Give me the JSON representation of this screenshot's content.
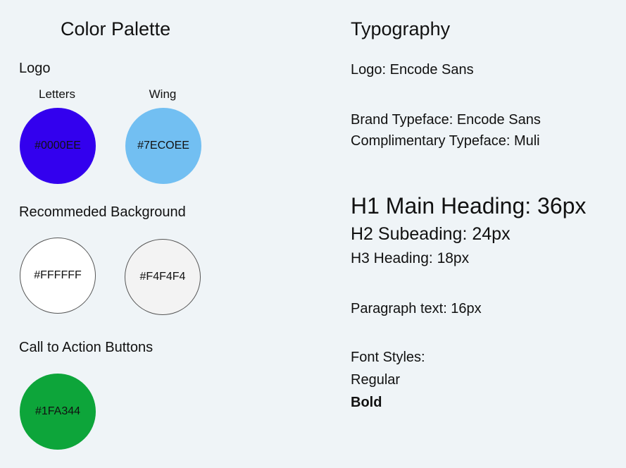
{
  "color_palette": {
    "title": "Color Palette",
    "logo": {
      "label": "Logo",
      "swatches": [
        {
          "caption": "Letters",
          "hex_label": "#0000EE",
          "color": "#3300EE"
        },
        {
          "caption": "Wing",
          "hex_label": "#7ECOEE",
          "color": "#72BFF2"
        }
      ]
    },
    "background": {
      "label": "Recommeded Background",
      "swatches": [
        {
          "hex_label": "#FFFFFF",
          "color": "#FFFFFF"
        },
        {
          "hex_label": "#F4F4F4",
          "color": "#F3F3F3"
        }
      ]
    },
    "cta": {
      "label": "Call to Action Buttons",
      "swatches": [
        {
          "hex_label": "#1FA344",
          "color": "#0DA53A"
        }
      ]
    }
  },
  "typography": {
    "title": "Typography",
    "logo_font": "Logo: Encode Sans",
    "brand_typeface": "Brand Typeface: Encode Sans",
    "complimentary_typeface": "Complimentary Typeface: Muli",
    "h1": "H1 Main Heading: 36px",
    "h2": "H2 Subeading: 24px",
    "h3": "H3 Heading: 18px",
    "paragraph": "Paragraph text: 16px",
    "font_styles_label": "Font Styles:",
    "regular": "Regular",
    "bold": "Bold"
  },
  "colors": {
    "page_background": "#EFF4F7",
    "text": "#111111"
  }
}
